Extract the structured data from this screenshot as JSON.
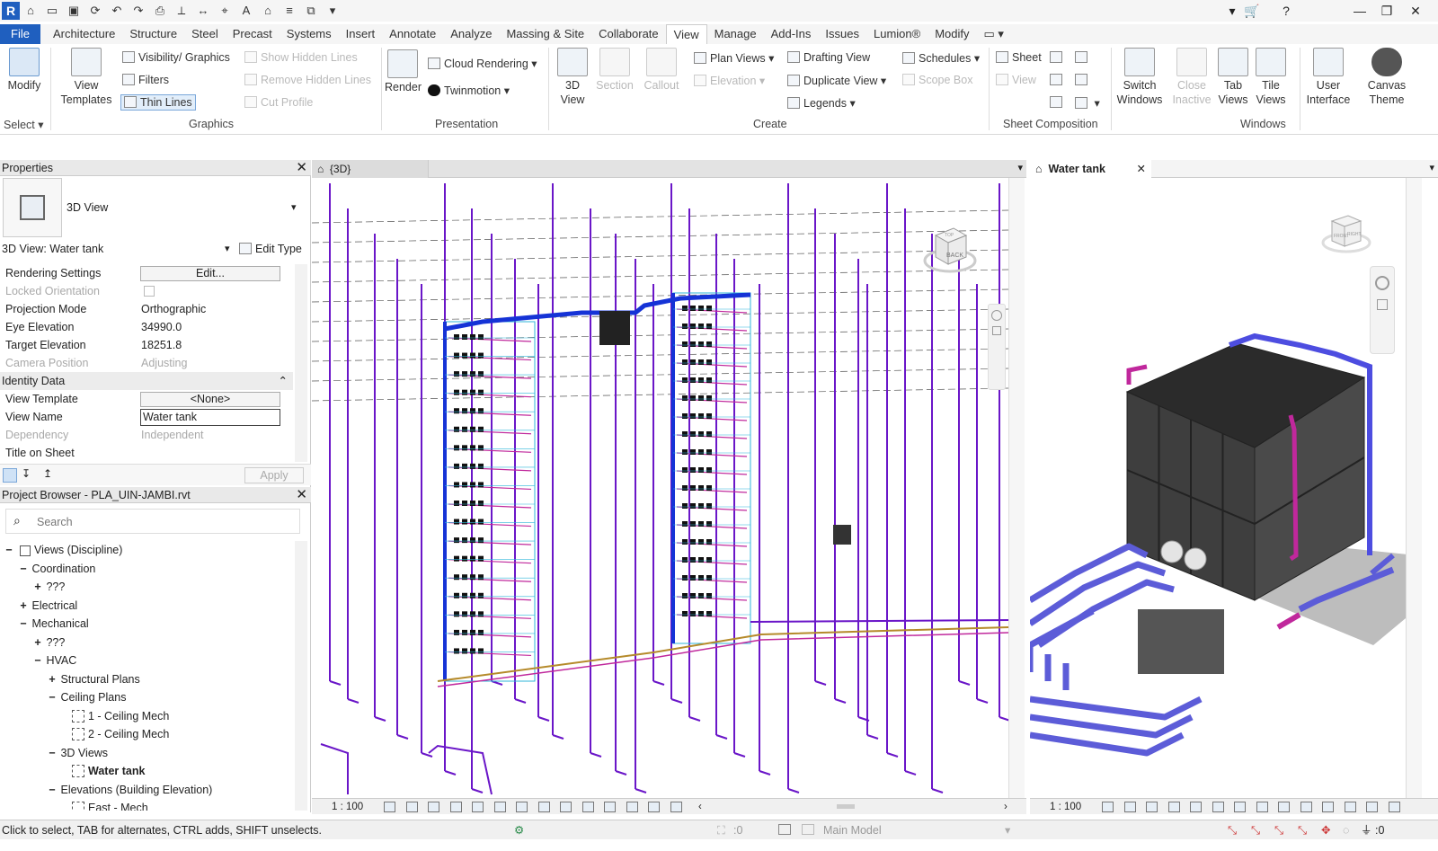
{
  "qat": {
    "app_letter": "R"
  },
  "tabs": [
    "File",
    "Architecture",
    "Structure",
    "Steel",
    "Precast",
    "Systems",
    "Insert",
    "Annotate",
    "Analyze",
    "Massing & Site",
    "Collaborate",
    "View",
    "Manage",
    "Add-Ins",
    "Issues",
    "Lumion®",
    "Modify"
  ],
  "active_tab": "View",
  "ribbon": {
    "modify": "Modify",
    "select": "Select",
    "view_templates_1": "View",
    "view_templates_2": "Templates",
    "visibility_graphics": "Visibility/ Graphics",
    "filters": "Filters",
    "thin_lines": "Thin Lines",
    "show_hidden_lines": "Show Hidden Lines",
    "remove_hidden_lines": "Remove Hidden Lines",
    "cut_profile": "Cut Profile",
    "graphics_label": "Graphics",
    "render": "Render",
    "cloud_rendering": "Cloud Rendering",
    "twinmotion": "Twinmotion",
    "presentation_label": "Presentation",
    "view_3d_1": "3D",
    "view_3d_2": "View",
    "section": "Section",
    "callout": "Callout",
    "plan_views": "Plan Views",
    "elevation": "Elevation",
    "drafting_view": "Drafting View",
    "duplicate_view": "Duplicate View",
    "legends": "Legends",
    "schedules": "Schedules",
    "scope_box": "Scope Box",
    "create_label": "Create",
    "sheet": "Sheet",
    "view": "View",
    "sheet_composition_label": "Sheet Composition",
    "switch_windows_1": "Switch",
    "switch_windows_2": "Windows",
    "close_inactive_1": "Close",
    "close_inactive_2": "Inactive",
    "tab_views_1": "Tab",
    "tab_views_2": "Views",
    "tile_views_1": "Tile",
    "tile_views_2": "Views",
    "windows_label": "Windows",
    "user_interface_1": "User",
    "user_interface_2": "Interface",
    "canvas_theme_1": "Canvas",
    "canvas_theme_2": "Theme"
  },
  "properties": {
    "title": "Properties",
    "type_name": "3D View",
    "instance": "3D View: Water tank",
    "edit_type": "Edit Type",
    "rows": [
      {
        "k": "Rendering Settings",
        "v": "Edit..."
      },
      {
        "k": "Locked Orientation",
        "v": ""
      },
      {
        "k": "Projection Mode",
        "v": "Orthographic"
      },
      {
        "k": "Eye Elevation",
        "v": "34990.0"
      },
      {
        "k": "Target Elevation",
        "v": "18251.8"
      },
      {
        "k": "Camera Position",
        "v": "Adjusting"
      }
    ],
    "identity_header": "Identity Data",
    "identity_rows": [
      {
        "k": "View Template",
        "v": "<None>"
      },
      {
        "k": "View Name",
        "v": "Water tank"
      },
      {
        "k": "Dependency",
        "v": "Independent"
      },
      {
        "k": "Title on Sheet",
        "v": ""
      }
    ],
    "apply": "Apply"
  },
  "browser": {
    "title": "Project Browser - PLA_UIN-JAMBI.rvt",
    "search_placeholder": "Search",
    "tree": [
      {
        "t": "Views (Discipline)",
        "lvl": 0,
        "g": "−",
        "box": true
      },
      {
        "t": "Coordination",
        "lvl": 1,
        "g": "−"
      },
      {
        "t": "???",
        "lvl": 2,
        "g": "+"
      },
      {
        "t": "Electrical",
        "lvl": 1,
        "g": "+"
      },
      {
        "t": "Mechanical",
        "lvl": 1,
        "g": "−"
      },
      {
        "t": "???",
        "lvl": 2,
        "g": "+"
      },
      {
        "t": "HVAC",
        "lvl": 2,
        "g": "−"
      },
      {
        "t": "Structural Plans",
        "lvl": 3,
        "g": "+"
      },
      {
        "t": "Ceiling Plans",
        "lvl": 3,
        "g": "−"
      },
      {
        "t": "1 - Ceiling Mech",
        "lvl": 4,
        "g": "",
        "view": true
      },
      {
        "t": "2 - Ceiling Mech",
        "lvl": 4,
        "g": "",
        "view": true
      },
      {
        "t": "3D Views",
        "lvl": 3,
        "g": "−"
      },
      {
        "t": "Water tank",
        "lvl": 4,
        "g": "",
        "view": true,
        "bold": true
      },
      {
        "t": "Elevations (Building Elevation)",
        "lvl": 3,
        "g": "−"
      },
      {
        "t": "East - Mech",
        "lvl": 4,
        "g": "",
        "view": true
      }
    ]
  },
  "views": {
    "left_tab": "{3D}",
    "right_tab": "Water tank",
    "scale": "1 : 100",
    "viewcube_back": "BACK",
    "viewcube_top": "TOP",
    "viewcube_front": "FRONT",
    "viewcube_right": "RIGHT"
  },
  "status": {
    "hint": "Click to select, TAB for alternates, CTRL adds, SHIFT unselects.",
    "worksets": ":0",
    "model": "Main Model",
    "filter": ":0"
  },
  "colors": {
    "file_tab": "#1f5fbf",
    "pipe_purple": "#6a16c8",
    "pipe_blue": "#1533d6",
    "pipe_magenta": "#c0289c",
    "pipe_cyan": "#2fb6d9"
  }
}
